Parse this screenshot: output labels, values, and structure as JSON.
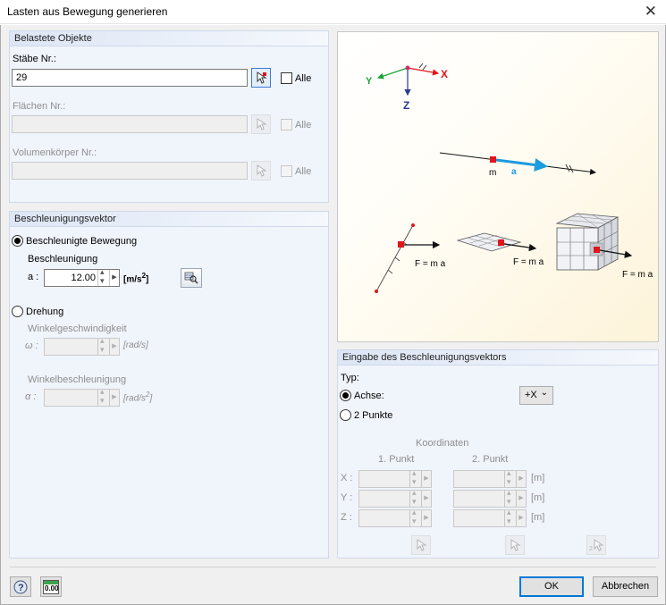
{
  "window": {
    "title": "Lasten aus Bewegung generieren"
  },
  "loaded_objects": {
    "header": "Belastete Objekte",
    "members": {
      "label": "Stäbe Nr.:",
      "value": "29",
      "all_label": "Alle"
    },
    "surfaces": {
      "label": "Flächen Nr.:",
      "value": "",
      "all_label": "Alle"
    },
    "solids": {
      "label": "Volumenkörper Nr.:",
      "value": "",
      "all_label": "Alle"
    }
  },
  "acceleration_vector": {
    "header": "Beschleunigungsvektor",
    "accelerated_motion": {
      "label": "Beschleunigte Bewegung",
      "checked": true
    },
    "acceleration": {
      "label": "Beschleunigung",
      "symbol": "a :",
      "value": "12.00",
      "unit_base": "[m/s",
      "unit_exp": "2",
      "unit_end": "]"
    },
    "rotation": {
      "label": "Drehung",
      "checked": false
    },
    "angular_velocity": {
      "label": "Winkelgeschwindigkeit",
      "symbol": "ω :",
      "value": "",
      "unit": "[rad/s]"
    },
    "angular_acceleration": {
      "label": "Winkelbeschleunigung",
      "symbol": "α :",
      "value": "",
      "unit_base": "[rad/s",
      "unit_exp": "2",
      "unit_end": "]"
    }
  },
  "illustration": {
    "axis_x": "X",
    "axis_y": "Y",
    "axis_z": "Z",
    "mass_label": "m",
    "accel_label": "a",
    "formula": "F = m a"
  },
  "input_vector": {
    "header": "Eingabe des Beschleunigungsvektors",
    "type_label": "Typ:",
    "axis": {
      "label": "Achse:",
      "checked": true,
      "selected": "+X"
    },
    "two_points": {
      "label": "2 Punkte",
      "checked": false
    },
    "coordinates_label": "Koordinaten",
    "point1_label": "1. Punkt",
    "point2_label": "2. Punkt",
    "rows": [
      {
        "label": "X :",
        "unit": "[m]"
      },
      {
        "label": "Y :",
        "unit": "[m]"
      },
      {
        "label": "Z :",
        "unit": "[m]"
      }
    ]
  },
  "footer": {
    "ok_label": "OK",
    "cancel_label": "Abbrechen",
    "units_icon_text": "0.00"
  },
  "colors": {
    "accent_blue": "#0078d7",
    "marker_red": "#e0161c",
    "arrow_cyan": "#1b9be0"
  }
}
